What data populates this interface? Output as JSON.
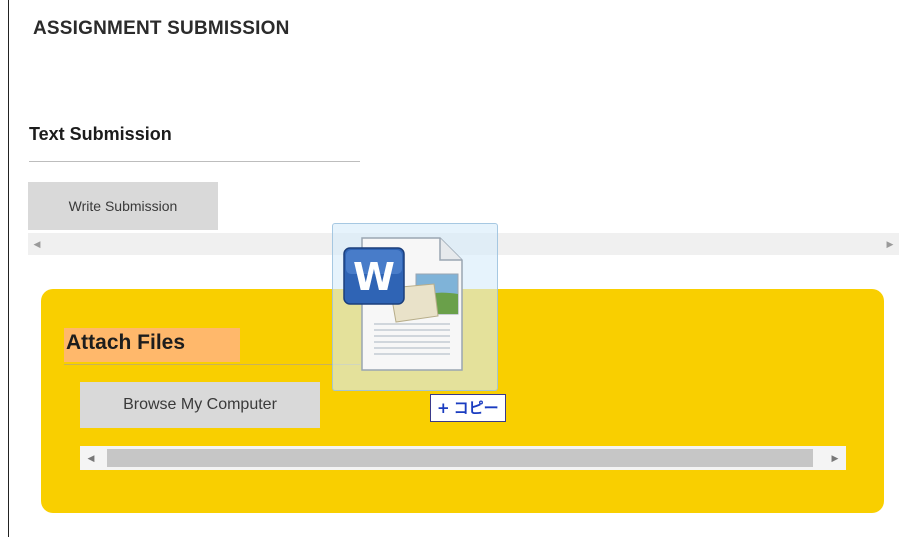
{
  "page": {
    "title": "ASSIGNMENT SUBMISSION"
  },
  "text_submission": {
    "heading": "Text Submission",
    "write_button_label": "Write Submission"
  },
  "attach_files": {
    "heading": "Attach Files",
    "browse_button_label": "Browse My Computer",
    "panel_color": "#f9cf00"
  },
  "drag": {
    "file_icon": "word-document-icon",
    "badge_plus": "+",
    "badge_label": "コピー"
  }
}
